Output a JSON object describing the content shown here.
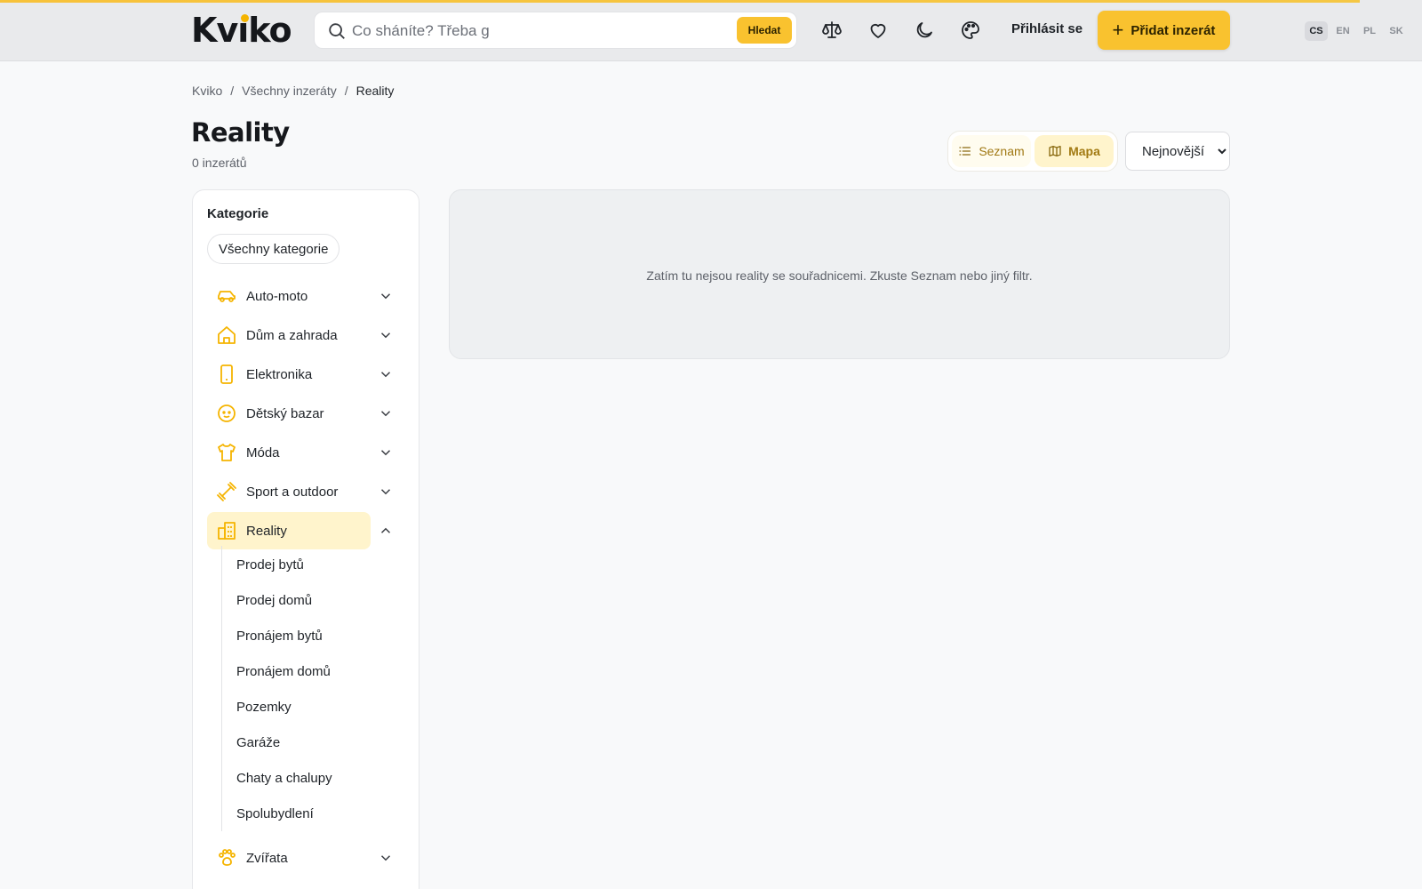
{
  "header": {
    "logo": "Kviko",
    "search_placeholder": "Co sháníte? Třeba g",
    "search_button": "Hledat",
    "login": "Přihlásit se",
    "add_listing": "Přidat inzerát",
    "languages": [
      "CS",
      "EN",
      "PL",
      "SK"
    ],
    "active_language": "CS",
    "accent_color": "#f9c22f"
  },
  "breadcrumb": [
    "Kviko",
    "Všechny inzeráty",
    "Reality"
  ],
  "page": {
    "title": "Reality",
    "count": "0 inzerátů"
  },
  "view_toggle": {
    "list_label": "Seznam",
    "map_label": "Mapa",
    "active": "map"
  },
  "sort": {
    "selected": "Nejnovější"
  },
  "sidebar": {
    "heading": "Kategorie",
    "all_categories": "Všechny kategorie",
    "categories": [
      {
        "label": "Auto-moto",
        "icon": "car-icon"
      },
      {
        "label": "Dům a zahrada",
        "icon": "house-icon"
      },
      {
        "label": "Elektronika",
        "icon": "phone-icon"
      },
      {
        "label": "Dětský bazar",
        "icon": "baby-icon"
      },
      {
        "label": "Móda",
        "icon": "shirt-icon"
      },
      {
        "label": "Sport a outdoor",
        "icon": "dumbbell-icon"
      },
      {
        "label": "Reality",
        "icon": "building-icon",
        "active": true
      },
      {
        "label": "Zvířata",
        "icon": "paw-icon"
      }
    ],
    "subcategories": [
      "Prodej bytů",
      "Prodej domů",
      "Pronájem bytů",
      "Pronájem domů",
      "Pozemky",
      "Garáže",
      "Chaty a chalupy",
      "Spolubydlení"
    ]
  },
  "map": {
    "empty_message": "Zatím tu nejsou reality se souřadnicemi. Zkuste Seznam nebo jiný filtr."
  }
}
